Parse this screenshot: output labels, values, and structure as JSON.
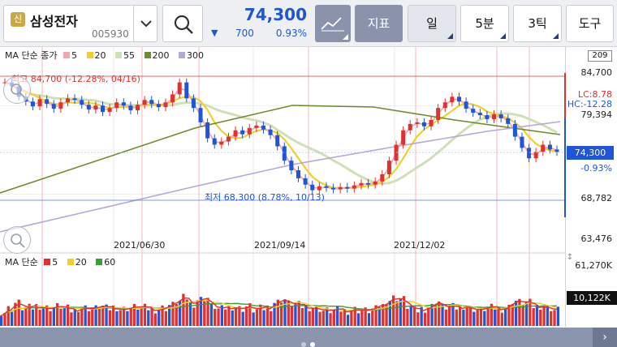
{
  "toolbar": {
    "stock_badge": "신",
    "stock_name": "삼성전자",
    "stock_code": "005930",
    "price": "74,300",
    "change_arrow": "▼",
    "change": "700",
    "change_pct": "0.93%",
    "indicator_label": "지표",
    "period_day": "일",
    "period_5min": "5분",
    "period_3tick": "3틱",
    "tools_label": "도구"
  },
  "legend_price": {
    "prefix": "MA 단순 종가",
    "items": [
      {
        "label": "5",
        "color": "#f4a6b0"
      },
      {
        "label": "20",
        "color": "#f1d02a"
      },
      {
        "label": "55",
        "color": "#cfe0b6"
      },
      {
        "label": "200",
        "color": "#6f8c2e"
      },
      {
        "label": "300",
        "color": "#b7a6d6"
      }
    ]
  },
  "legend_volume": {
    "prefix": "MA 단순",
    "items": [
      {
        "label": "5",
        "color": "#e0302f"
      },
      {
        "label": "20",
        "color": "#f1d02a"
      },
      {
        "label": "60",
        "color": "#3a9d3a"
      }
    ]
  },
  "annotations": {
    "high": "최고 84,700 (-12.28%, 04/16)",
    "low": "최저 68,300 (8.78%, 10/13)",
    "lc": "LC:8.78",
    "hc": "HC:-12.28",
    "count": "209"
  },
  "axis": {
    "y_ticks": [
      "84,700",
      "79,394",
      "68,782",
      "63,476"
    ],
    "current_price": "74,300",
    "current_pct": "-0.93%",
    "vol_max": "61,270K",
    "vol_current": "10,122K",
    "x_dates": [
      "2021/06/30",
      "2021/09/14",
      "2021/12/02"
    ]
  },
  "nav": {
    "next_label": "›"
  },
  "colors": {
    "accent_blue": "#1f55d6",
    "up_red": "#e0302f",
    "toolbar_dark": "#8a93ab"
  },
  "chart_data": {
    "type": "candlestick",
    "title": "",
    "ylim": [
      63476,
      85600
    ],
    "y_ticks": [
      84700,
      79394,
      68782,
      63476
    ],
    "x_labels": [
      "2021/06/30",
      "2021/09/14",
      "2021/12/02"
    ],
    "high": 84700,
    "low": 68300,
    "last_close": 74300,
    "close_series": [
      83000,
      82500,
      81200,
      80600,
      80000,
      80900,
      80300,
      79700,
      80500,
      81000,
      80800,
      80200,
      79600,
      80100,
      79300,
      79800,
      80500,
      80100,
      79500,
      80200,
      80800,
      80300,
      79900,
      80500,
      81500,
      83000,
      81000,
      79800,
      78000,
      76000,
      75200,
      75600,
      76200,
      77000,
      76500,
      77300,
      77600,
      77100,
      76400,
      75000,
      73200,
      72000,
      71000,
      70200,
      69500,
      70000,
      69800,
      69600,
      69900,
      69700,
      70100,
      70400,
      70200,
      70600,
      71500,
      73200,
      75200,
      77000,
      77800,
      78000,
      77500,
      78300,
      79800,
      80500,
      81200,
      80600,
      79700,
      79200,
      78900,
      78400,
      79000,
      78500,
      77800,
      76200,
      74800,
      73500,
      74300,
      75200,
      74600,
      74300
    ],
    "volume_max_label": "61,270K",
    "volume_last_label": "10,122K"
  }
}
